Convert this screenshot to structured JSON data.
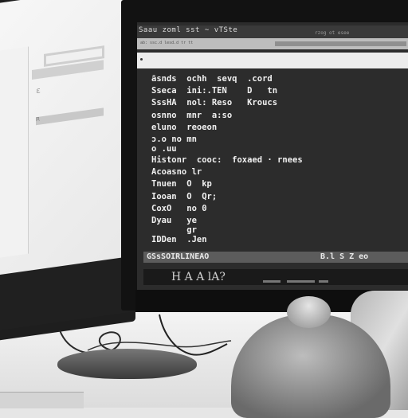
{
  "scene": {
    "description": "Black and white photo of a desk with two computer monitors, a mouse with cables and a hand",
    "palette": {
      "wall": "#e0e0e0",
      "monitor_bezel": "#121212",
      "terminal_bg": "#2c2c2c",
      "terminal_text": "#f0f0f0"
    }
  },
  "left_monitor": {
    "glyph_1": "ɛ",
    "glyph_2": "ʀ"
  },
  "right_monitor": {
    "window": {
      "title": "Saau zoml sst ~ vTSte",
      "title_right": "rzog ot esee",
      "menu_text": "ab: ssc.d lesd.d tr tt"
    },
    "terminal_lines": [
      "ãsnds  ochh  sevq  .cord",
      "Sseca  ini:.TEN    D   tn",
      "SssHA  nol: Reso   Kroucs",
      "osnno  mnr  a:so",
      "eluno  reoeon",
      "ɔ.o no mn",
      "o .uu",
      "Histonr  cooc:  foxaed · rnees",
      "Acoasno lr",
      "Tnuen  O  kp",
      "Iooan  O  Qr;",
      "CoxO   no 0",
      "Dyau   ye",
      "       gr",
      "IDDen  .Jen"
    ],
    "status_bar": {
      "left": "GSsSOIRLINEAO",
      "right": "B.l  S  Z  eo"
    },
    "taskbar_text": "H  A  A  lA?"
  },
  "desk": {
    "objects": [
      "mouse-with-cables",
      "hand",
      "keyboard-edge"
    ]
  }
}
